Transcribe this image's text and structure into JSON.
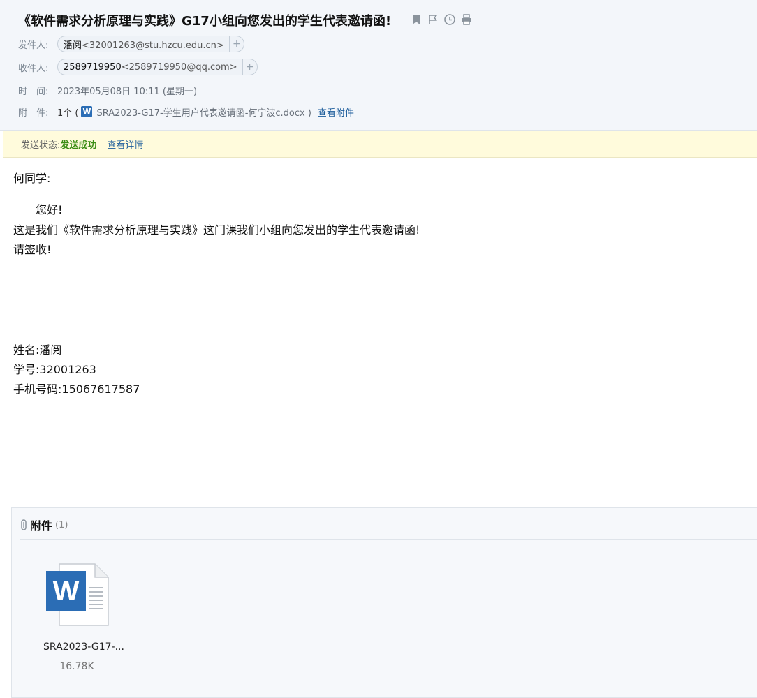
{
  "subject": {
    "title": "《软件需求分析原理与实践》G17小组向您发出的学生代表邀请函!",
    "icons": [
      "bookmark-icon",
      "flag-icon",
      "clock-icon",
      "print-icon"
    ]
  },
  "from": {
    "label": "发件人:",
    "name": "潘阅",
    "address": "<32001263@stu.hzcu.edu.cn>",
    "add": "+"
  },
  "to": {
    "label": "收件人:",
    "name": "2589719950",
    "address": "<2589719950@qq.com>",
    "add": "+"
  },
  "time": {
    "label": "时　间:",
    "value": "2023年05月08日 10:11 (星期一)"
  },
  "attachment_line": {
    "label": "附　件:",
    "count": "1个 (",
    "word_glyph": "W",
    "filename": "SRA2023-G17-学生用户代表邀请函-何宁波c.docx )",
    "view_link": "查看附件"
  },
  "status": {
    "label": "发送状态:",
    "value": "发送成功",
    "detail_link": "查看详情"
  },
  "body": {
    "greeting": "何同学:",
    "hello": "您好!",
    "line1": "这是我们《软件需求分析原理与实践》这门课我们小组向您发出的学生代表邀请函!",
    "line2": "请签收!",
    "sig_name": "姓名:潘阅",
    "sig_id": "学号:32001263",
    "sig_phone": "手机号码:15067617587"
  },
  "attachments_panel": {
    "title": "附件",
    "count": "(1)",
    "file_name": "SRA2023-G17-...",
    "file_size": "16.78K",
    "word_glyph": "W"
  },
  "colors": {
    "link": "#1a5b9a",
    "success": "#3b8d14",
    "status_bg": "#fffbdc",
    "header_bg": "#f3f6fa",
    "word_blue": "#2b6db5"
  }
}
